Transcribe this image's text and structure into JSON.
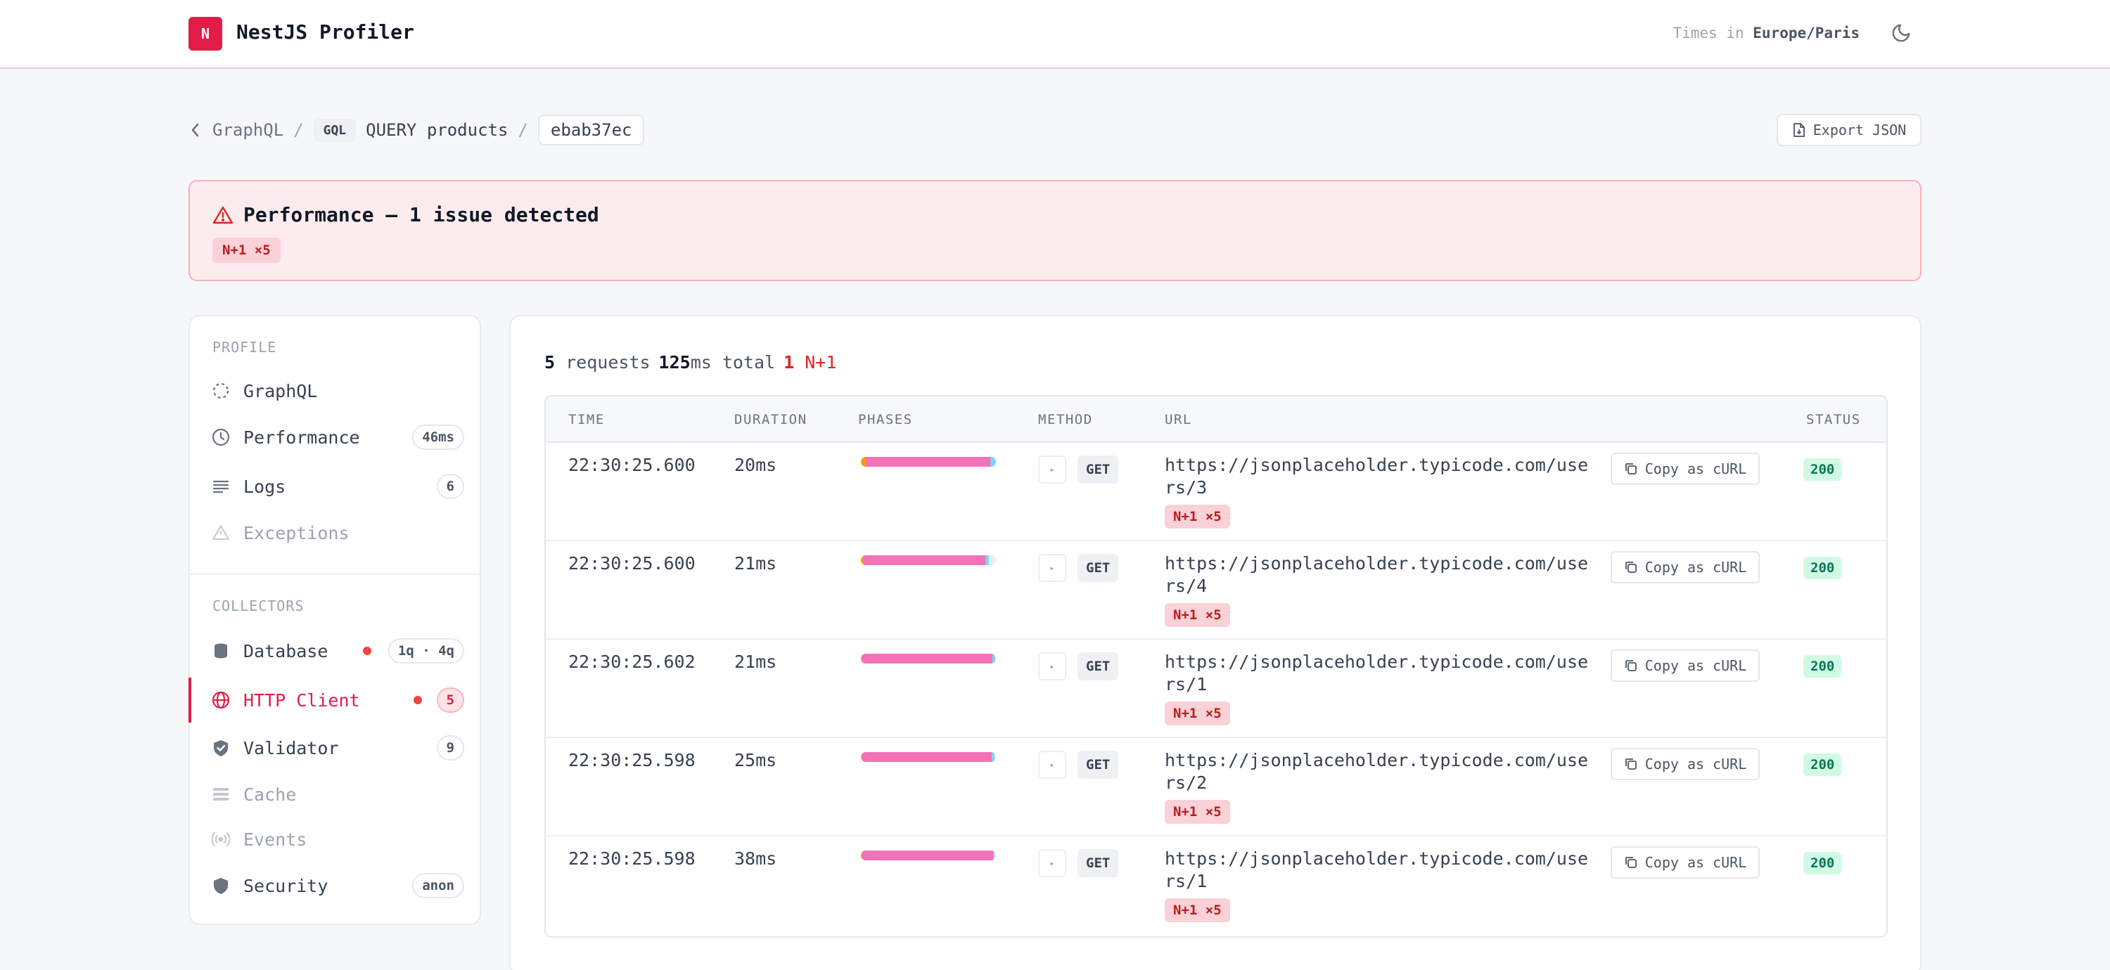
{
  "header": {
    "logo_letter": "N",
    "title": "NestJS Profiler",
    "tz_prefix": "Times in",
    "tz_value": "Europe/Paris"
  },
  "breadcrumb": {
    "parent": "GraphQL",
    "sep": "/",
    "kind": "GQL",
    "query": "QUERY products",
    "token": "ebab37ec"
  },
  "export_label": "Export JSON",
  "alert": {
    "title": "Performance — 1 issue detected",
    "badge": "N+1 ×5"
  },
  "sidebar": {
    "profile_heading": "PROFILE",
    "collectors_heading": "COLLECTORS",
    "profile_items": [
      {
        "label": "GraphQL",
        "badge": ""
      },
      {
        "label": "Performance",
        "badge": "46ms"
      },
      {
        "label": "Logs",
        "badge": "6"
      },
      {
        "label": "Exceptions",
        "badge": ""
      }
    ],
    "collector_items": [
      {
        "label": "Database",
        "badge": "1q · 4q"
      },
      {
        "label": "HTTP Client",
        "badge": "5"
      },
      {
        "label": "Validator",
        "badge": "9"
      },
      {
        "label": "Cache",
        "badge": ""
      },
      {
        "label": "Events",
        "badge": ""
      },
      {
        "label": "Security",
        "badge": "anon"
      }
    ]
  },
  "summary": {
    "requests_count": "5",
    "requests_label": "requests",
    "total_value": "125",
    "total_label": "ms total",
    "n1_count": "1",
    "n1_label": "N+1"
  },
  "table": {
    "headers": [
      "TIME",
      "DURATION",
      "PHASES",
      "METHOD",
      "URL",
      "STATUS"
    ],
    "curl_label": "Copy as cURL",
    "expand_glyph": "▸",
    "rows": [
      {
        "time": "22:30:25.600",
        "duration": "20ms",
        "method": "GET",
        "url": "https://jsonplaceholder.typicode.com/users/3",
        "badge": "N+1 ×5",
        "status": "200",
        "phases": [
          0.03,
          0.06,
          0.87,
          0.04
        ]
      },
      {
        "time": "22:30:25.600",
        "duration": "21ms",
        "method": "GET",
        "url": "https://jsonplaceholder.typicode.com/users/4",
        "badge": "N+1 ×5",
        "status": "200",
        "phases": [
          0.02,
          0.06,
          0.84,
          0.03
        ]
      },
      {
        "time": "22:30:25.602",
        "duration": "21ms",
        "method": "GET",
        "url": "https://jsonplaceholder.typicode.com/users/1",
        "badge": "N+1 ×5",
        "status": "200",
        "phases": [
          0.005,
          0.01,
          0.96,
          0.02
        ]
      },
      {
        "time": "22:30:25.598",
        "duration": "25ms",
        "method": "GET",
        "url": "https://jsonplaceholder.typicode.com/users/2",
        "badge": "N+1 ×5",
        "status": "200",
        "phases": [
          0.01,
          0.02,
          0.94,
          0.02
        ]
      },
      {
        "time": "22:30:25.598",
        "duration": "38ms",
        "method": "GET",
        "url": "https://jsonplaceholder.typicode.com/users/1",
        "badge": "N+1 ×5",
        "status": "200",
        "phases": [
          0.01,
          0.02,
          0.95,
          0.01
        ]
      }
    ]
  },
  "colors": {
    "accent": "#e11d48",
    "phase_dns": "#f59e0b",
    "phase_connect": "#f472b6",
    "phase_wait": "#f472b6",
    "phase_download": "#7dd3fc",
    "status_ok_bg": "#d1fae5"
  }
}
